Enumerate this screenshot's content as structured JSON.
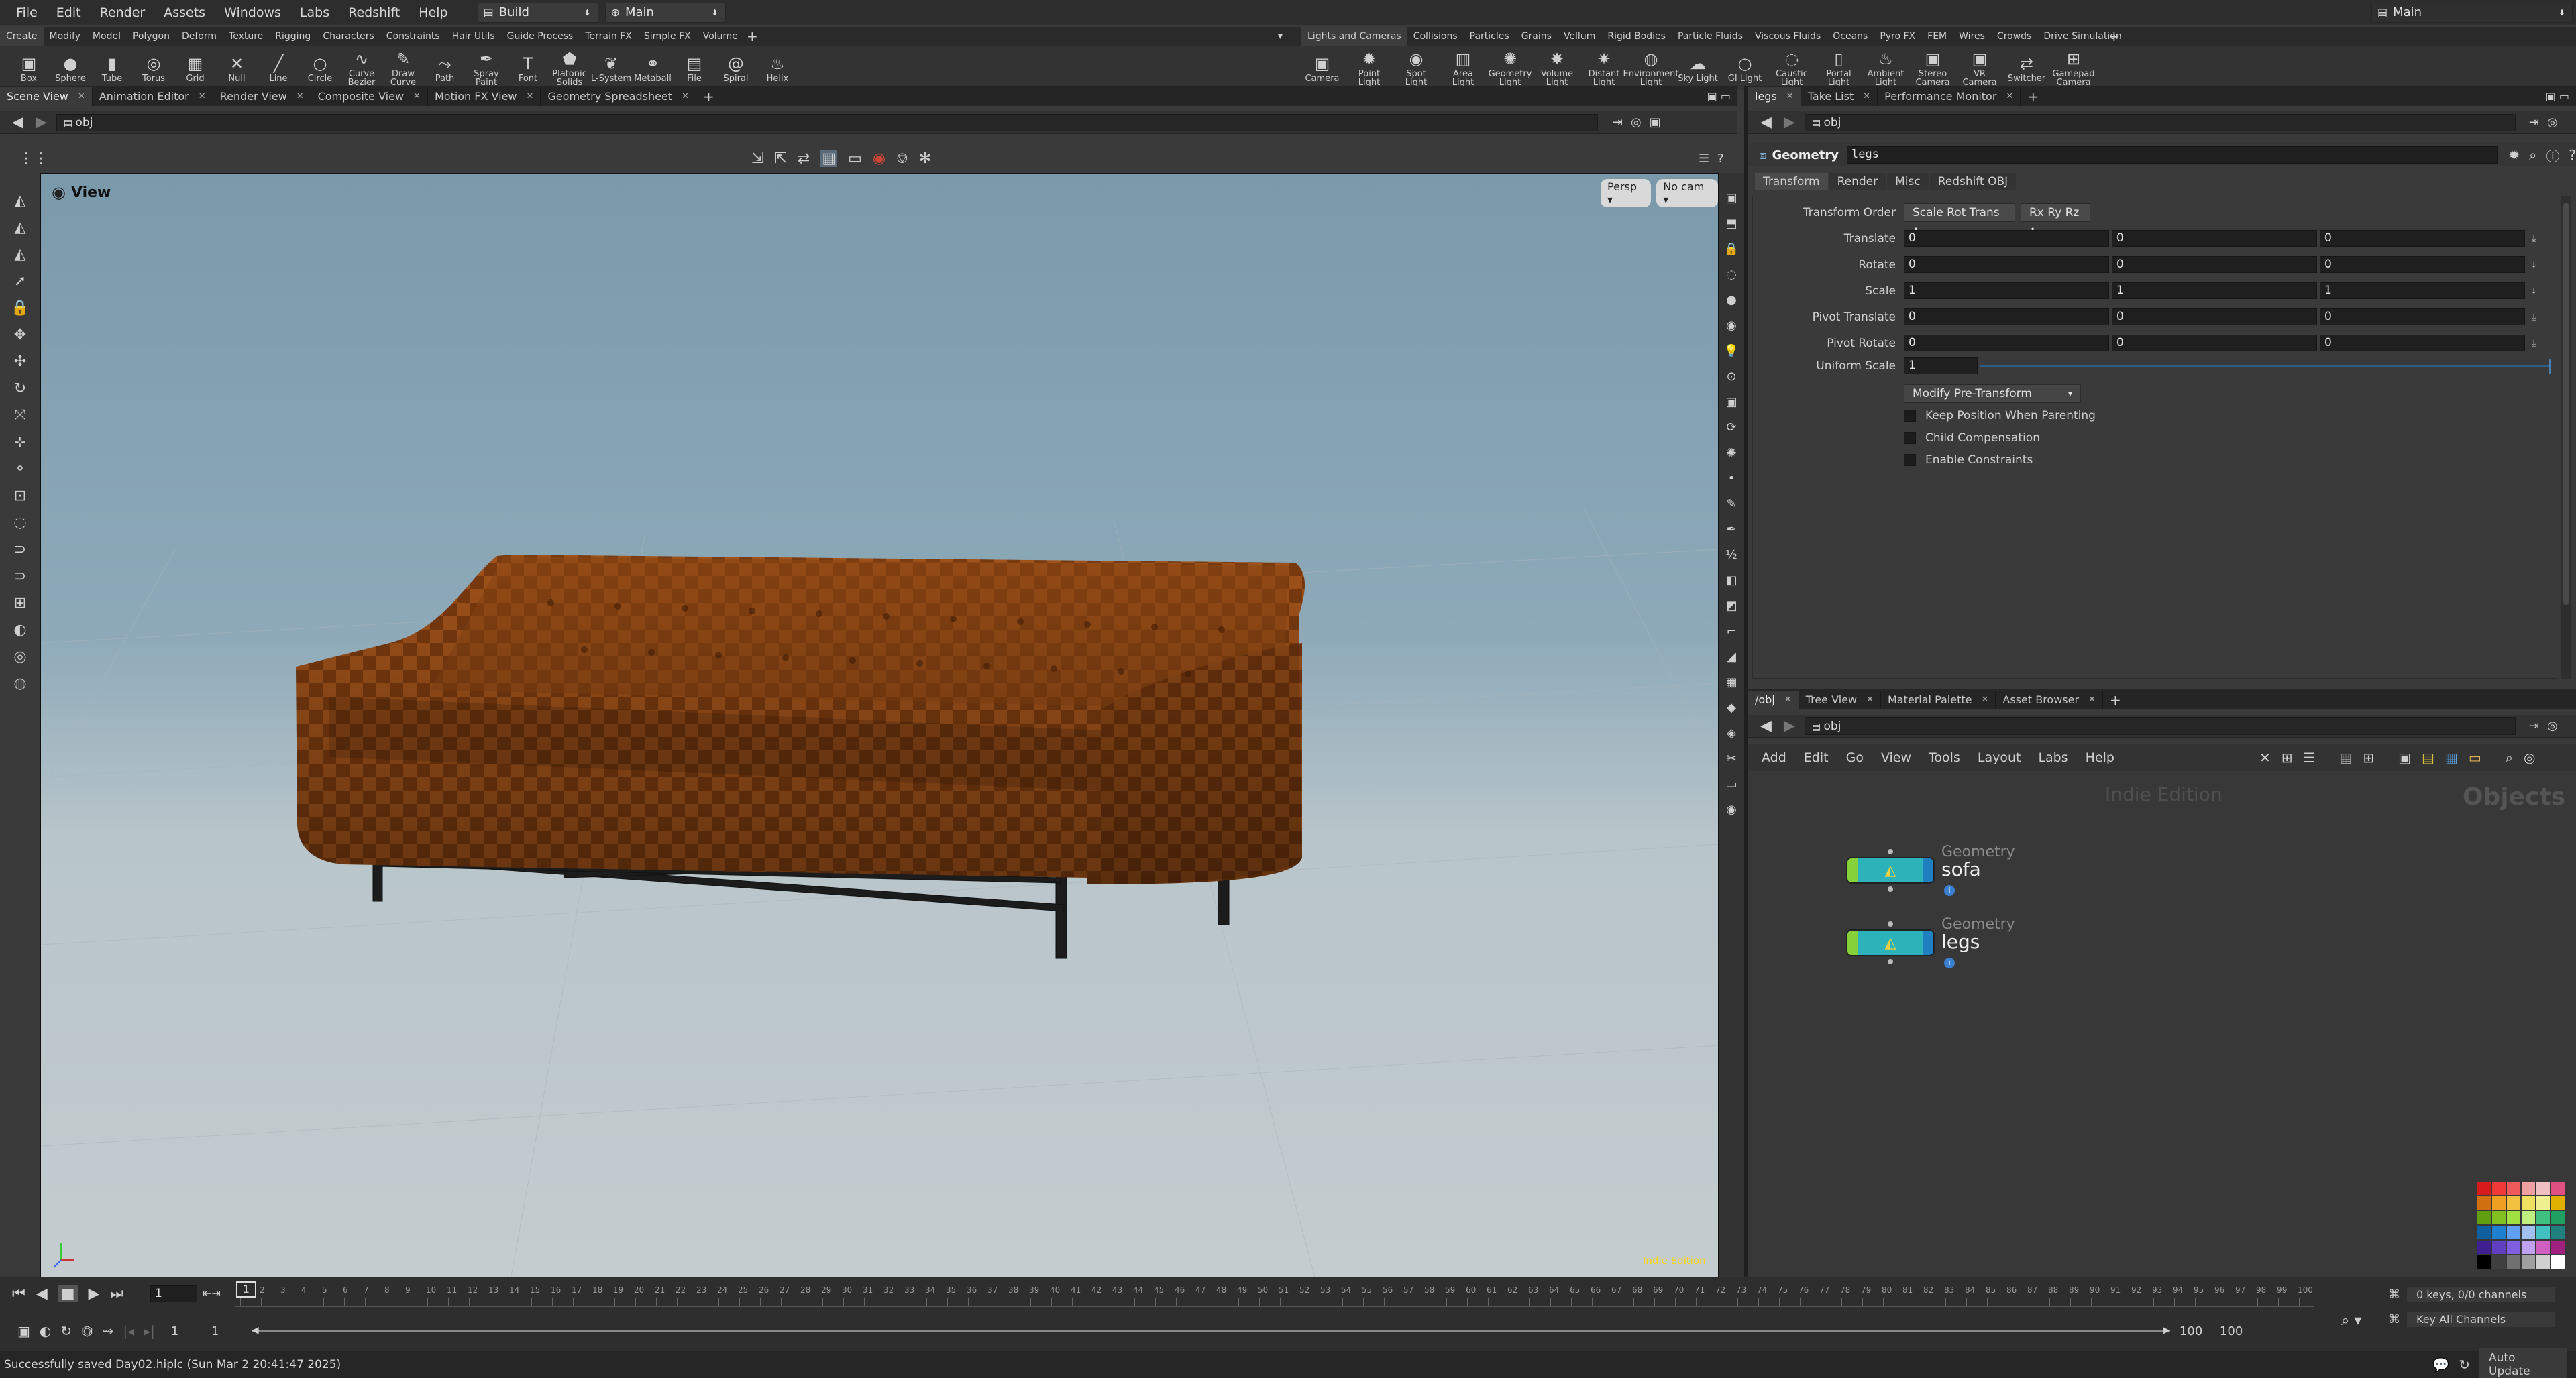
{
  "menubar": {
    "items": [
      "File",
      "Edit",
      "Render",
      "Assets",
      "Windows",
      "Labs",
      "Redshift",
      "Help"
    ],
    "desktop": "Build",
    "context": "Main",
    "right_context": "Main"
  },
  "shelf": {
    "left_tabs": [
      "Create",
      "Modify",
      "Model",
      "Polygon",
      "Deform",
      "Texture",
      "Rigging",
      "Characters",
      "Constraints",
      "Hair Utils",
      "Guide Process",
      "Terrain FX",
      "Simple FX",
      "Volume"
    ],
    "right_tabs": [
      "Lights and Cameras",
      "Collisions",
      "Particles",
      "Grains",
      "Vellum",
      "Rigid Bodies",
      "Particle Fluids",
      "Viscous Fluids",
      "Oceans",
      "Pyro FX",
      "FEM",
      "Wires",
      "Crowds",
      "Drive Simulation"
    ],
    "left_tools": [
      {
        "label": "Box",
        "icon": "box-icon",
        "glyph": "▣"
      },
      {
        "label": "Sphere",
        "icon": "sphere-icon",
        "glyph": "●"
      },
      {
        "label": "Tube",
        "icon": "tube-icon",
        "glyph": "▮"
      },
      {
        "label": "Torus",
        "icon": "torus-icon",
        "glyph": "◎"
      },
      {
        "label": "Grid",
        "icon": "grid-icon",
        "glyph": "▦"
      },
      {
        "label": "Null",
        "icon": "null-icon",
        "glyph": "✕"
      },
      {
        "label": "Line",
        "icon": "line-icon",
        "glyph": "╱"
      },
      {
        "label": "Circle",
        "icon": "circle-icon",
        "glyph": "○"
      },
      {
        "label": "Curve Bezier",
        "icon": "curve-bezier-icon",
        "glyph": "∿"
      },
      {
        "label": "Draw Curve",
        "icon": "draw-curve-icon",
        "glyph": "✎"
      },
      {
        "label": "Path",
        "icon": "path-icon",
        "glyph": "⤳"
      },
      {
        "label": "Spray Paint",
        "icon": "spray-paint-icon",
        "glyph": "✒"
      },
      {
        "label": "Font",
        "icon": "font-icon",
        "glyph": "T"
      },
      {
        "label": "Platonic Solids",
        "icon": "platonic-solids-icon",
        "glyph": "⬟"
      },
      {
        "label": "L-System",
        "icon": "l-system-icon",
        "glyph": "❦"
      },
      {
        "label": "Metaball",
        "icon": "metaball-icon",
        "glyph": "⚭"
      },
      {
        "label": "File",
        "icon": "file-icon",
        "glyph": "▤"
      },
      {
        "label": "Spiral",
        "icon": "spiral-icon",
        "glyph": "@"
      },
      {
        "label": "Helix",
        "icon": "helix-icon",
        "glyph": "♨"
      }
    ],
    "right_tools": [
      {
        "label": "Camera",
        "icon": "camera-icon",
        "glyph": "▣"
      },
      {
        "label": "Point Light",
        "icon": "point-light-icon",
        "glyph": "✹"
      },
      {
        "label": "Spot Light",
        "icon": "spot-light-icon",
        "glyph": "◉"
      },
      {
        "label": "Area Light",
        "icon": "area-light-icon",
        "glyph": "▥"
      },
      {
        "label": "Geometry Light",
        "icon": "geometry-light-icon",
        "glyph": "✺"
      },
      {
        "label": "Volume Light",
        "icon": "volume-light-icon",
        "glyph": "✸"
      },
      {
        "label": "Distant Light",
        "icon": "distant-light-icon",
        "glyph": "✷"
      },
      {
        "label": "Environment Light",
        "icon": "environment-light-icon",
        "glyph": "◍"
      },
      {
        "label": "Sky Light",
        "icon": "sky-light-icon",
        "glyph": "☁"
      },
      {
        "label": "GI Light",
        "icon": "gi-light-icon",
        "glyph": "○"
      },
      {
        "label": "Caustic Light",
        "icon": "caustic-light-icon",
        "glyph": "◌"
      },
      {
        "label": "Portal Light",
        "icon": "portal-light-icon",
        "glyph": "▯"
      },
      {
        "label": "Ambient Light",
        "icon": "ambient-light-icon",
        "glyph": "♨"
      },
      {
        "label": "Stereo Camera",
        "icon": "stereo-camera-icon",
        "glyph": "▣"
      },
      {
        "label": "VR Camera",
        "icon": "vr-camera-icon",
        "glyph": "▣"
      },
      {
        "label": "Switcher",
        "icon": "switcher-icon",
        "glyph": "⇄"
      },
      {
        "label": "Gamepad Camera",
        "icon": "gamepad-camera-icon",
        "glyph": "⊞"
      }
    ]
  },
  "left_pane": {
    "tabs": [
      "Scene View",
      "Animation Editor",
      "Render View",
      "Composite View",
      "Motion FX View",
      "Geometry Spreadsheet"
    ],
    "path": "obj",
    "view_label": "View",
    "persp_button": "Persp",
    "cam_button": "No cam",
    "watermark": "Indie Edition"
  },
  "params": {
    "tabs_top": [
      "legs",
      "Take List",
      "Performance Monitor"
    ],
    "path": "obj",
    "node_type": "Geometry",
    "node_name": "legs",
    "subtabs": [
      "Transform",
      "Render",
      "Misc",
      "Redshift OBJ"
    ],
    "transform_order_label": "Transform Order",
    "transform_order_value": "Scale Rot Trans",
    "rotate_order_value": "Rx Ry Rz",
    "rows": [
      {
        "label": "Translate",
        "x": "0",
        "y": "0",
        "z": "0"
      },
      {
        "label": "Rotate",
        "x": "0",
        "y": "0",
        "z": "0"
      },
      {
        "label": "Scale",
        "x": "1",
        "y": "1",
        "z": "1"
      },
      {
        "label": "Pivot Translate",
        "x": "0",
        "y": "0",
        "z": "0"
      },
      {
        "label": "Pivot Rotate",
        "x": "0",
        "y": "0",
        "z": "0"
      }
    ],
    "uniform_scale_label": "Uniform Scale",
    "uniform_scale_value": "1",
    "modify_button": "Modify Pre-Transform",
    "checkboxes": [
      "Keep Position When Parenting",
      "Child Compensation",
      "Enable Constraints"
    ]
  },
  "network": {
    "tabs": [
      "/obj",
      "Tree View",
      "Material Palette",
      "Asset Browser"
    ],
    "path": "obj",
    "menu": [
      "Add",
      "Edit",
      "Go",
      "View",
      "Tools",
      "Layout",
      "Labs",
      "Help"
    ],
    "watermark": "Indie Edition",
    "context_label": "Objects",
    "nodes": [
      {
        "type": "Geometry",
        "name": "sofa"
      },
      {
        "type": "Geometry",
        "name": "legs"
      }
    ]
  },
  "timeline": {
    "current_frame": "1",
    "frame_field": "1",
    "start": "1",
    "start2": "1",
    "end": "100",
    "end2": "100",
    "ticks": [
      "1",
      "2",
      "3",
      "4",
      "5",
      "6",
      "7",
      "8",
      "9",
      "10",
      "11",
      "12",
      "13",
      "14",
      "15",
      "16",
      "17",
      "18",
      "19",
      "20",
      "21",
      "22",
      "23",
      "24",
      "25",
      "26",
      "27",
      "28",
      "29",
      "30",
      "31",
      "32",
      "33",
      "34",
      "35",
      "36",
      "37",
      "38",
      "39",
      "40",
      "41",
      "42",
      "43",
      "44",
      "45",
      "46",
      "47",
      "48",
      "49",
      "50",
      "51",
      "52",
      "53",
      "54",
      "55",
      "56",
      "57",
      "58",
      "59",
      "60",
      "61",
      "62",
      "63",
      "64",
      "65",
      "66",
      "67",
      "68",
      "69",
      "70",
      "71",
      "72",
      "73",
      "74",
      "75",
      "76",
      "77",
      "78",
      "79",
      "80",
      "81",
      "82",
      "83",
      "84",
      "85",
      "86",
      "87",
      "88",
      "89",
      "90",
      "91",
      "92",
      "93",
      "94",
      "95",
      "96",
      "97",
      "98",
      "99",
      "100"
    ],
    "keys_label": "0 keys, 0/0 channels",
    "key_all_label": "Key All Channels"
  },
  "status": {
    "message": "Successfully saved Day02.hiplc (Sun Mar  2 20:41:47 2025)",
    "auto_update": "Auto Update"
  },
  "colors": {
    "accent": "#ffd700",
    "sofa_base": "#a0521a",
    "node_green": "#86d03a",
    "node_teal": "#2bb3b9"
  }
}
